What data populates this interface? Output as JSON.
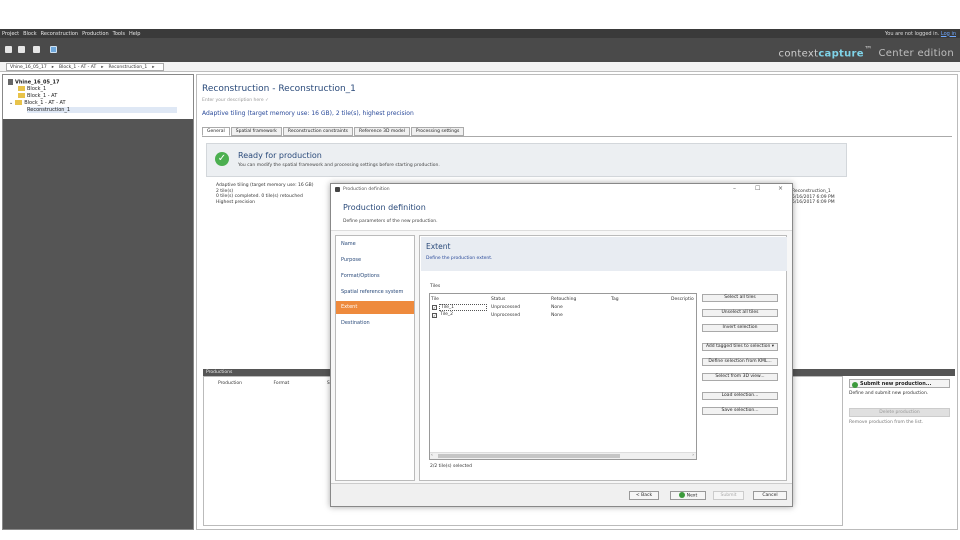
{
  "menubar": {
    "items": [
      "Project",
      "Block",
      "Reconstruction",
      "Production",
      "Tools",
      "Help"
    ],
    "login_text": "You are not logged in.",
    "login_link": "Log in"
  },
  "toolbar": {
    "brand_main": "contextcapture",
    "brand_tm": "™",
    "brand_edition": "Center edition"
  },
  "breadcrumb": [
    "Vhine_16_05_17",
    "Block_1 - AT - AT",
    "Reconstruction_1"
  ],
  "tree": {
    "project": "Vhine_16_05_17",
    "items": [
      "Block_1",
      "Block_1 - AT",
      "Block_1 - AT - AT",
      "Reconstruction_1"
    ]
  },
  "reconstruction": {
    "title": "Reconstruction - Reconstruction_1",
    "description_placeholder": "Enter your description here",
    "summary": "Adaptive tiling (target memory use: 16 GB), 2 tile(s), highest precision",
    "tabs": [
      "General",
      "Spatial framework",
      "Reconstruction constraints",
      "Reference 3D model",
      "Processing settings"
    ],
    "status_title": "Ready for production",
    "status_sub": "You can modify the spatial framework and processing settings before starting production.",
    "info_left": [
      "Adaptive tiling (target memory use: 16 GB)",
      "2 tile(s)",
      "0 tile(s) completed. 0 tile(s) retouched",
      "Highest precision"
    ],
    "info_right": [
      "Reconstruction_1",
      "5/16/2017 6:09 PM",
      "5/16/2017 6:09 PM"
    ]
  },
  "productions": {
    "header": "Productions",
    "columns": [
      "Production",
      "Format",
      "S"
    ],
    "submit_label": "Submit new production...",
    "submit_desc": "Define and submit new production.",
    "delete_label": "Delete production",
    "delete_desc": "Remove production from the list."
  },
  "dialog": {
    "window_title": "Production definition",
    "heading": "Production definition",
    "subheading": "Define parameters of the new production.",
    "minimize": "–",
    "maximize": "☐",
    "close": "×",
    "nav": [
      "Name",
      "Purpose",
      "Format/Options",
      "Spatial reference system",
      "Extent",
      "Destination"
    ],
    "active_nav": "Extent",
    "extent_title": "Extent",
    "extent_sub": "Define the production extent.",
    "tiles_label": "Tiles",
    "columns": [
      "Tile",
      "Status",
      "Retouching",
      "Tag",
      "Descriptio"
    ],
    "rows": [
      {
        "tile": "Tile_1",
        "status": "Unprocessed",
        "retouching": "None",
        "checked": "✓"
      },
      {
        "tile": "Tile_2",
        "status": "Unprocessed",
        "retouching": "None",
        "checked": "✓"
      }
    ],
    "selection_count": "2/2 tile(s) selected",
    "buttons": [
      "Select all tiles",
      "Unselect all tiles",
      "Invert selection",
      "Add tagged tiles to selection ▾",
      "Define selection from KML...",
      "Select from 3D view...",
      "Load selection...",
      "Save selection..."
    ],
    "back": "< Back",
    "next": "Next",
    "submit": "Submit",
    "cancel": "Cancel"
  }
}
